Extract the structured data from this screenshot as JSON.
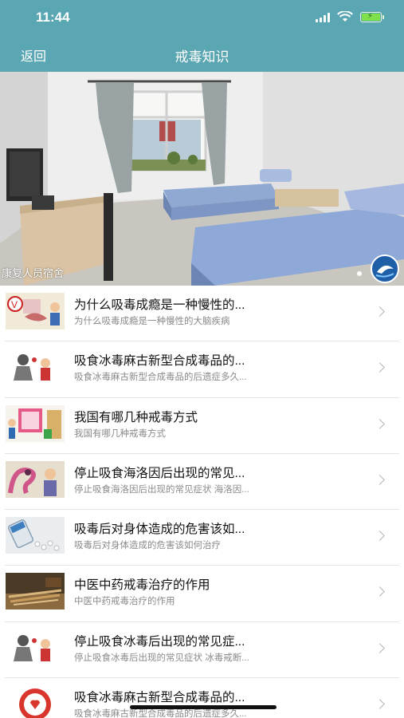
{
  "status_bar": {
    "time": "11:44"
  },
  "nav": {
    "back_label": "返回",
    "title": "戒毒知识"
  },
  "banner": {
    "caption": "康复人员宿舍"
  },
  "articles": [
    {
      "title": "为什么吸毒成瘾是一种慢性的...",
      "subtitle": "为什么吸毒成瘾是一种慢性的大脑疾病"
    },
    {
      "title": "吸食冰毒麻古新型合成毒品的...",
      "subtitle": "吸食冰毒麻古新型合成毒品的后遗症多久..."
    },
    {
      "title": "我国有哪几种戒毒方式",
      "subtitle": "我国有哪几种戒毒方式"
    },
    {
      "title": "停止吸食海洛因后出现的常见...",
      "subtitle": "停止吸食海洛因后出现的常见症状 海洛因..."
    },
    {
      "title": "吸毒后对身体造成的危害该如...",
      "subtitle": "吸毒后对身体造成的危害该如何治疗"
    },
    {
      "title": "中医中药戒毒治疗的作用",
      "subtitle": "中医中药戒毒治疗的作用"
    },
    {
      "title": "停止吸食冰毒后出现的常见症...",
      "subtitle": "停止吸食冰毒后出现的常见症状 冰毒戒断..."
    },
    {
      "title": "吸食冰毒麻古新型合成毒品的...",
      "subtitle": "吸食冰毒麻古新型合成毒品的后遗症多久..."
    }
  ],
  "colors": {
    "header": "#5aa6b2",
    "title_text": "#111111",
    "subtitle_text": "#8a8a8a"
  }
}
